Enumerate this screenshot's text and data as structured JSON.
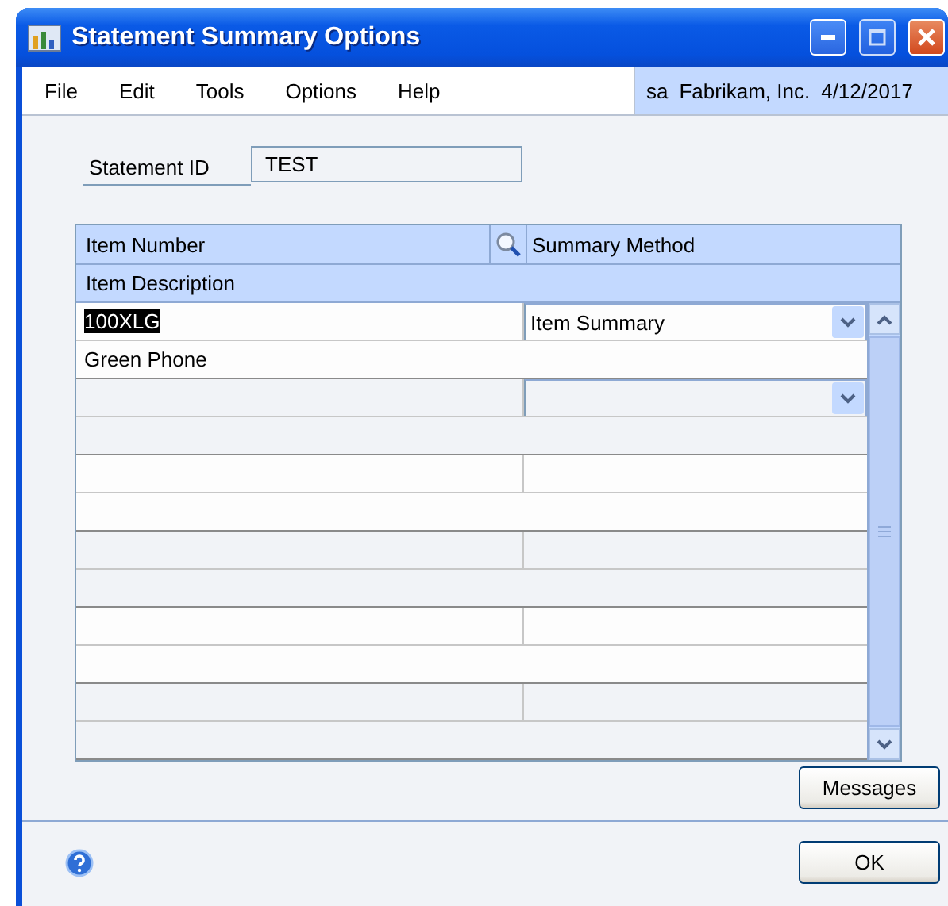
{
  "window": {
    "title": "Statement Summary Options"
  },
  "menu": [
    "File",
    "Edit",
    "Tools",
    "Options",
    "Help"
  ],
  "user_info": {
    "user": "sa",
    "company": "Fabrikam, Inc.",
    "date": "4/12/2017"
  },
  "statement_id": {
    "label": "Statement ID",
    "value": "TEST"
  },
  "grid": {
    "columns": [
      "Item Number",
      "Summary Method"
    ],
    "second_line_column": "Item Description",
    "rows": [
      {
        "item_number": "100XLG",
        "item_number_selected": true,
        "summary_method": "Item Summary",
        "description": "Green Phone",
        "dropdown": true
      },
      {
        "dropdown": true
      },
      {
        "dropdown": false
      },
      {
        "dropdown": false
      },
      {
        "dropdown": false
      },
      {
        "dropdown": false
      }
    ]
  },
  "buttons": {
    "messages": "Messages",
    "ok": "OK"
  }
}
